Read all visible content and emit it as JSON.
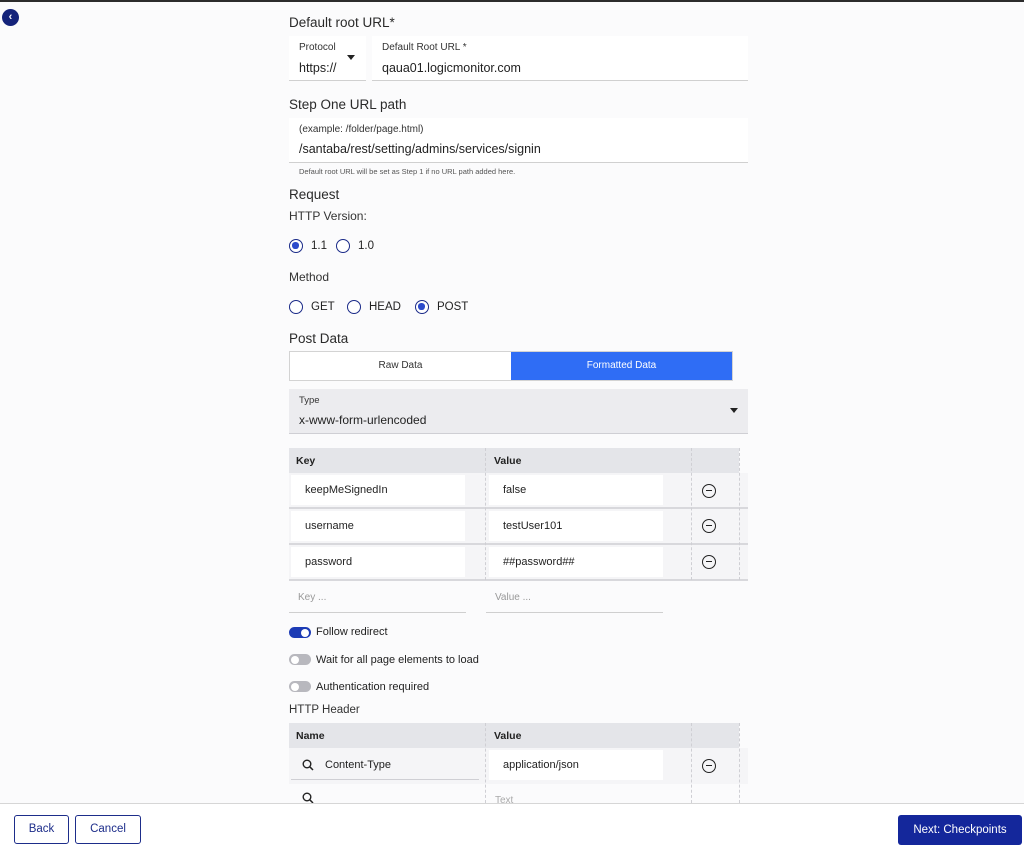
{
  "root_url": {
    "title": "Default root URL*",
    "protocol_label": "Protocol",
    "protocol_value": "https://",
    "url_label": "Default Root URL *",
    "url_value": "qaua01.logicmonitor.com"
  },
  "step_one": {
    "title": "Step One URL path",
    "placeholder_label": "(example: /folder/page.html)",
    "value": "/santaba/rest/setting/admins/services/signin",
    "hint": "Default root URL will be set as Step 1 if no URL path added here."
  },
  "request": {
    "title": "Request",
    "http_version_label": "HTTP Version:",
    "http_versions": [
      {
        "label": "1.1",
        "selected": true
      },
      {
        "label": "1.0",
        "selected": false
      }
    ],
    "method_label": "Method",
    "methods": [
      {
        "label": "GET",
        "selected": false
      },
      {
        "label": "HEAD",
        "selected": false
      },
      {
        "label": "POST",
        "selected": true
      }
    ]
  },
  "post_data": {
    "title": "Post Data",
    "tabs": [
      {
        "label": "Raw Data",
        "active": false
      },
      {
        "label": "Formatted Data",
        "active": true
      }
    ],
    "type_label": "Type",
    "type_value": "x-www-form-urlencoded",
    "table": {
      "key_header": "Key",
      "value_header": "Value",
      "rows": [
        {
          "key": "keepMeSignedIn",
          "value": "false"
        },
        {
          "key": "username",
          "value": "testUser101"
        },
        {
          "key": "password",
          "value": "##password##"
        }
      ],
      "key_placeholder": "Key ...",
      "value_placeholder": "Value ..."
    }
  },
  "toggles": [
    {
      "label": "Follow redirect",
      "on": true
    },
    {
      "label": "Wait for all page elements to load",
      "on": false
    },
    {
      "label": "Authentication required",
      "on": false
    }
  ],
  "http_header": {
    "title": "HTTP Header",
    "name_header": "Name",
    "value_header": "Value",
    "rows": [
      {
        "name": "Content-Type",
        "value": "application/json"
      }
    ],
    "value_placeholder": "Text"
  },
  "footer": {
    "back_label": "Back",
    "cancel_label": "Cancel",
    "next_label": "Next: Checkpoints"
  },
  "colors": {
    "primary": "#14279b",
    "accent": "#2f6df5",
    "toggle_on": "#1c3bb5"
  }
}
